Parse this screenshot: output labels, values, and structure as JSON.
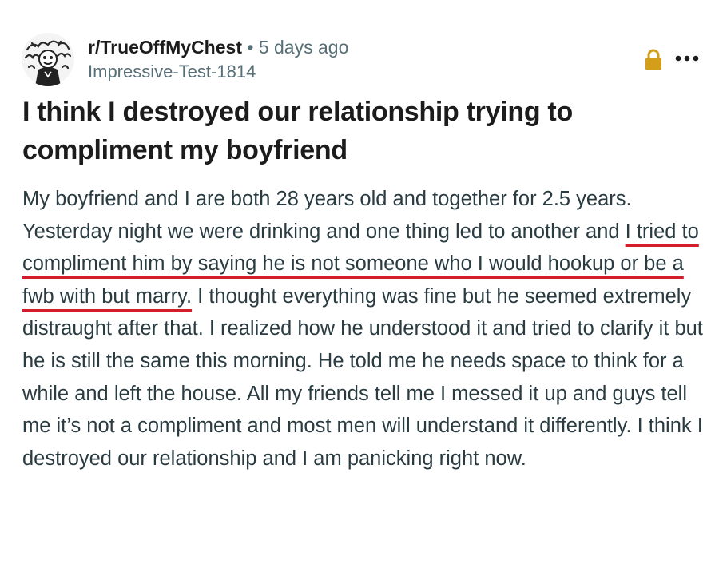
{
  "post": {
    "subreddit": "r/TrueOffMyChest",
    "separator": "•",
    "time_ago": "5 days ago",
    "username": "Impressive-Test-1814",
    "title": "I think I destroyed our relationship trying to compliment my boyfriend",
    "body_before": "My boyfriend and I are both 28 years old and together for 2.5 years. Yesterday night we were drinking and one thing led to another and ",
    "body_highlight": "I tried to compliment him by saying he is not someone who I would hookup or be a fwb with but marry.",
    "body_after": " I thought everything was fine but he seemed extremely distraught after that. I realized how he understood it and tried to clarify it but he is still the same this morning. He told me he needs space to think for a while and left the house. All my friends tell me I messed it up and guys tell me it’s not a compliment and most men will understand it differently. I think I destroyed our relationship and I am panicking right now."
  },
  "icons": {
    "avatar": "avatar",
    "lock": "lock-icon",
    "more": "more-options-icon"
  },
  "colors": {
    "highlight_underline": "#d21e2b",
    "lock": "#d39e1a",
    "meta_text": "#576f76",
    "body_text": "#2a3c42"
  }
}
